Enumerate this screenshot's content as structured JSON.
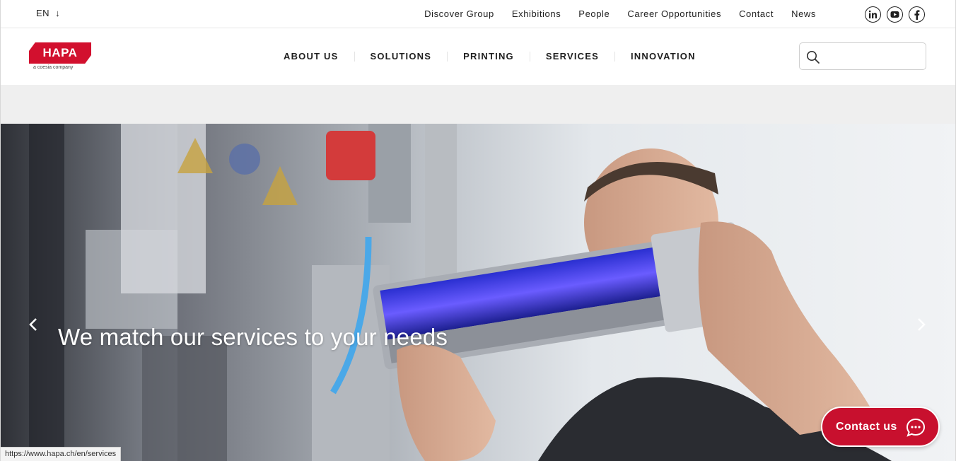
{
  "topbar": {
    "language": "EN",
    "links": [
      "Discover Group",
      "Exhibitions",
      "People",
      "Career Opportunities",
      "Contact",
      "News"
    ],
    "socials": [
      "linkedin-icon",
      "youtube-icon",
      "facebook-icon"
    ]
  },
  "logo": {
    "name": "HAPA",
    "tagline": "a coesia company",
    "brand_color": "#d2102e"
  },
  "nav": {
    "items": [
      "ABOUT US",
      "SOLUTIONS",
      "PRINTING",
      "SERVICES",
      "INNOVATION"
    ]
  },
  "search": {
    "value": "",
    "placeholder": ""
  },
  "hero": {
    "title": "We match our services to your needs"
  },
  "contact_button": {
    "label": "Contact us",
    "color": "#c8102e"
  },
  "status": {
    "url": "https://www.hapa.ch/en/services"
  }
}
